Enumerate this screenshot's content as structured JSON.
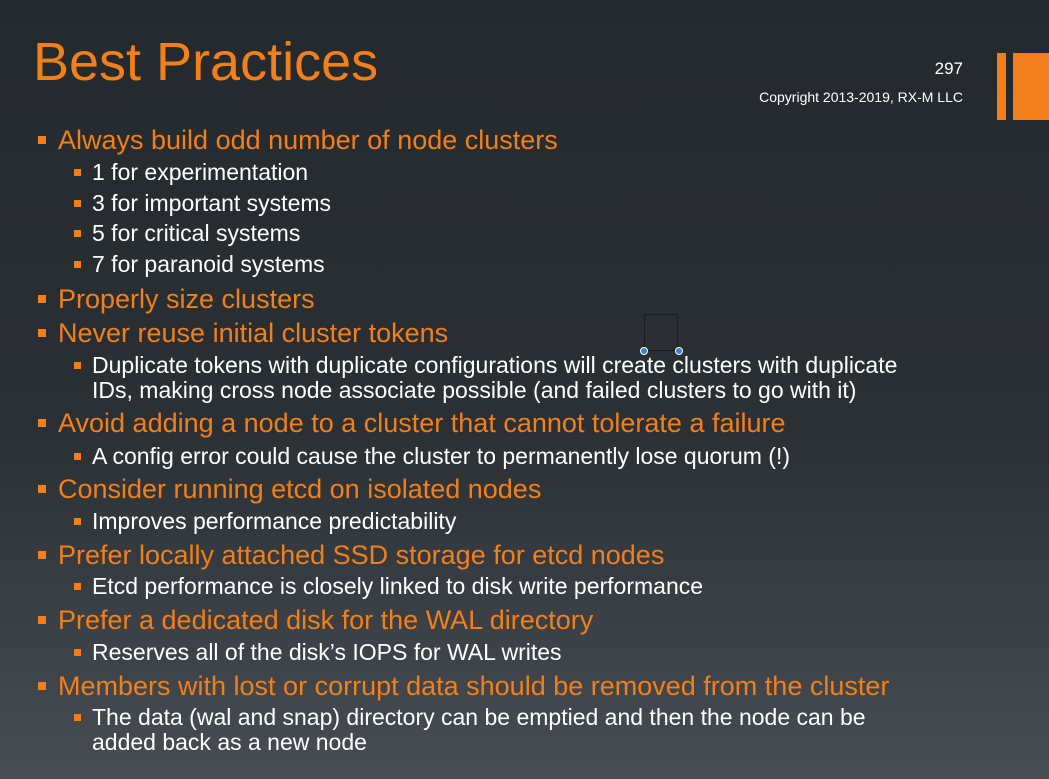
{
  "header": {
    "title": "Best Practices",
    "slide_number": "297",
    "copyright": "Copyright 2013-2019, RX-M LLC"
  },
  "colors": {
    "accent": "#f2801a",
    "text": "#ffffff",
    "background": "#2b3035"
  },
  "bullets": [
    {
      "level": 1,
      "text": "Always build odd number of node clusters"
    },
    {
      "level": 2,
      "text": "1 for experimentation"
    },
    {
      "level": 2,
      "text": "3 for important systems"
    },
    {
      "level": 2,
      "text": "5 for critical systems"
    },
    {
      "level": 2,
      "text": "7 for paranoid systems"
    },
    {
      "level": 1,
      "text": "Properly size clusters"
    },
    {
      "level": 1,
      "text": "Never reuse initial cluster tokens"
    },
    {
      "level": 2,
      "text": "Duplicate tokens with duplicate configurations will create clusters with duplicate",
      "continuation": "IDs, making cross node associate possible (and failed clusters to go with it)"
    },
    {
      "level": 1,
      "text": "Avoid adding a node to a cluster that cannot tolerate a failure"
    },
    {
      "level": 2,
      "text": "A config error could cause the cluster to permanently lose quorum (!)"
    },
    {
      "level": 1,
      "text": "Consider running etcd on isolated nodes"
    },
    {
      "level": 2,
      "text": "Improves performance predictability"
    },
    {
      "level": 1,
      "text": "Prefer locally attached SSD storage for etcd nodes"
    },
    {
      "level": 2,
      "text": "Etcd performance is closely linked to disk write performance"
    },
    {
      "level": 1,
      "text": "Prefer a dedicated disk for the WAL directory"
    },
    {
      "level": 2,
      "text": "Reserves all of the disk’s IOPS for WAL writes"
    },
    {
      "level": 1,
      "text": "Members with lost or corrupt data should be removed from the cluster"
    },
    {
      "level": 2,
      "text": "The data (wal and snap) directory can be emptied and then the node can be",
      "continuation": "added back as a new node"
    }
  ]
}
